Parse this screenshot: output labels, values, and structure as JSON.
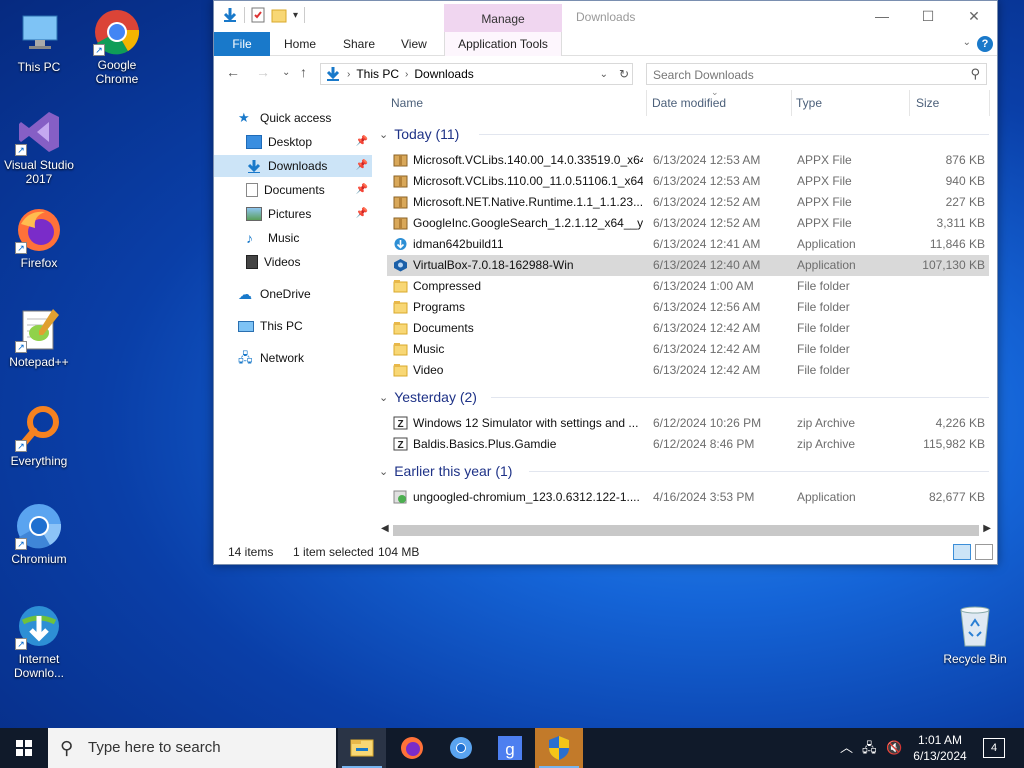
{
  "desktop": {
    "icons": [
      {
        "label": "This PC"
      },
      {
        "label": "Google Chrome"
      },
      {
        "label": "Visual Studio 2017"
      },
      {
        "label": "Firefox"
      },
      {
        "label": "Notepad++"
      },
      {
        "label": "Everything"
      },
      {
        "label": "Chromium"
      },
      {
        "label": "Internet Downlo..."
      },
      {
        "label": "Recycle Bin"
      }
    ]
  },
  "window": {
    "title": "Downloads",
    "context_tab": "Manage",
    "tabs": {
      "file": "File",
      "home": "Home",
      "share": "Share",
      "view": "View",
      "app_tools": "Application Tools"
    },
    "help": "?"
  },
  "address": {
    "crumbs": [
      "This PC",
      "Downloads"
    ],
    "search_placeholder": "Search Downloads"
  },
  "nav_pane": {
    "quick_access": "Quick access",
    "items": [
      {
        "label": "Desktop",
        "pinned": true
      },
      {
        "label": "Downloads",
        "pinned": true,
        "selected": true
      },
      {
        "label": "Documents",
        "pinned": true
      },
      {
        "label": "Pictures",
        "pinned": true
      },
      {
        "label": "Music"
      },
      {
        "label": "Videos"
      }
    ],
    "onedrive": "OneDrive",
    "this_pc": "This PC",
    "network": "Network"
  },
  "columns": {
    "name": "Name",
    "date": "Date modified",
    "type": "Type",
    "size": "Size"
  },
  "groups": [
    {
      "label": "Today (11)",
      "files": [
        {
          "name": "Microsoft.VCLibs.140.00_14.0.33519.0_x64...",
          "date": "6/13/2024 12:53 AM",
          "type": "APPX File",
          "size": "876 KB",
          "icon": "package-icon"
        },
        {
          "name": "Microsoft.VCLibs.110.00_11.0.51106.1_x64...",
          "date": "6/13/2024 12:53 AM",
          "type": "APPX File",
          "size": "940 KB",
          "icon": "package-icon"
        },
        {
          "name": "Microsoft.NET.Native.Runtime.1.1_1.1.23...",
          "date": "6/13/2024 12:52 AM",
          "type": "APPX File",
          "size": "227 KB",
          "icon": "package-icon"
        },
        {
          "name": "GoogleInc.GoogleSearch_1.2.1.12_x64__yf...",
          "date": "6/13/2024 12:52 AM",
          "type": "APPX File",
          "size": "3,311 KB",
          "icon": "package-icon"
        },
        {
          "name": "idman642build11",
          "date": "6/13/2024 12:41 AM",
          "type": "Application",
          "size": "11,846 KB",
          "icon": "idm-icon"
        },
        {
          "name": "VirtualBox-7.0.18-162988-Win",
          "date": "6/13/2024 12:40 AM",
          "type": "Application",
          "size": "107,130 KB",
          "icon": "virtualbox-icon",
          "selected": true
        },
        {
          "name": "Compressed",
          "date": "6/13/2024 1:00 AM",
          "type": "File folder",
          "size": "",
          "icon": "folder-icon"
        },
        {
          "name": "Programs",
          "date": "6/13/2024 12:56 AM",
          "type": "File folder",
          "size": "",
          "icon": "folder-icon"
        },
        {
          "name": "Documents",
          "date": "6/13/2024 12:42 AM",
          "type": "File folder",
          "size": "",
          "icon": "folder-icon"
        },
        {
          "name": "Music",
          "date": "6/13/2024 12:42 AM",
          "type": "File folder",
          "size": "",
          "icon": "folder-icon"
        },
        {
          "name": "Video",
          "date": "6/13/2024 12:42 AM",
          "type": "File folder",
          "size": "",
          "icon": "folder-icon"
        }
      ]
    },
    {
      "label": "Yesterday (2)",
      "files": [
        {
          "name": "Windows 12 Simulator with settings and ...",
          "date": "6/12/2024 10:26 PM",
          "type": "zip Archive",
          "size": "4,226 KB",
          "icon": "zip-icon"
        },
        {
          "name": "Baldis.Basics.Plus.Gamdie",
          "date": "6/12/2024 8:46 PM",
          "type": "zip Archive",
          "size": "115,982 KB",
          "icon": "zip-icon"
        }
      ]
    },
    {
      "label": "Earlier this year (1)",
      "files": [
        {
          "name": "ungoogled-chromium_123.0.6312.122-1....",
          "date": "4/16/2024 3:53 PM",
          "type": "Application",
          "size": "82,677 KB",
          "icon": "installer-icon"
        }
      ]
    }
  ],
  "status": {
    "items": "14 items",
    "selected": "1 item selected",
    "size": "104 MB"
  },
  "taskbar": {
    "search_placeholder": "Type here to search",
    "time": "1:01 AM",
    "date": "6/13/2024",
    "notifications": "4"
  }
}
